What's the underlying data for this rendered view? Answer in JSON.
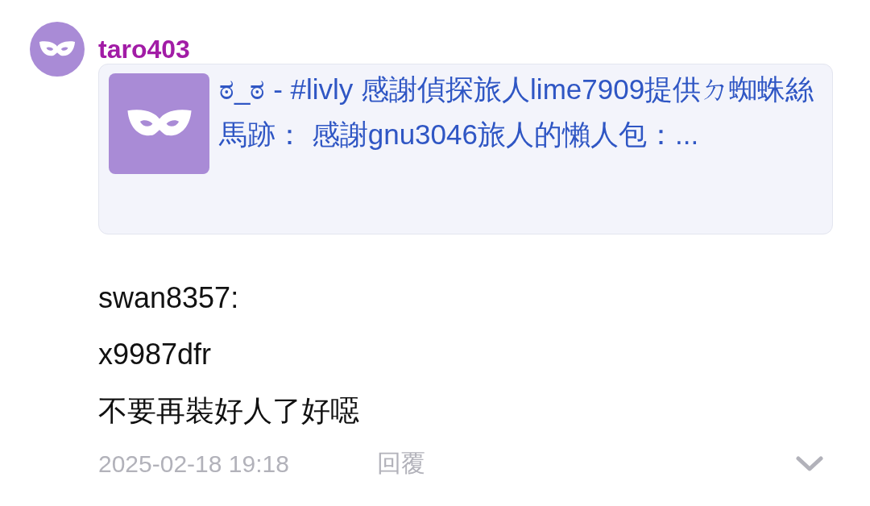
{
  "comment": {
    "author": "taro403",
    "quote": {
      "kind": "picture",
      "text": "ಠ_ಠ - #livly 感謝偵探旅人lime7909提供ㄉ蜘蛛絲馬跡： 感謝gnu3046旅人的懶人包：..."
    },
    "lines": [
      "swan8357:",
      "x9987dfr",
      "不要再裝好人了好噁"
    ],
    "timestamp": "2025-02-18 19:18",
    "reply": "回覆"
  }
}
